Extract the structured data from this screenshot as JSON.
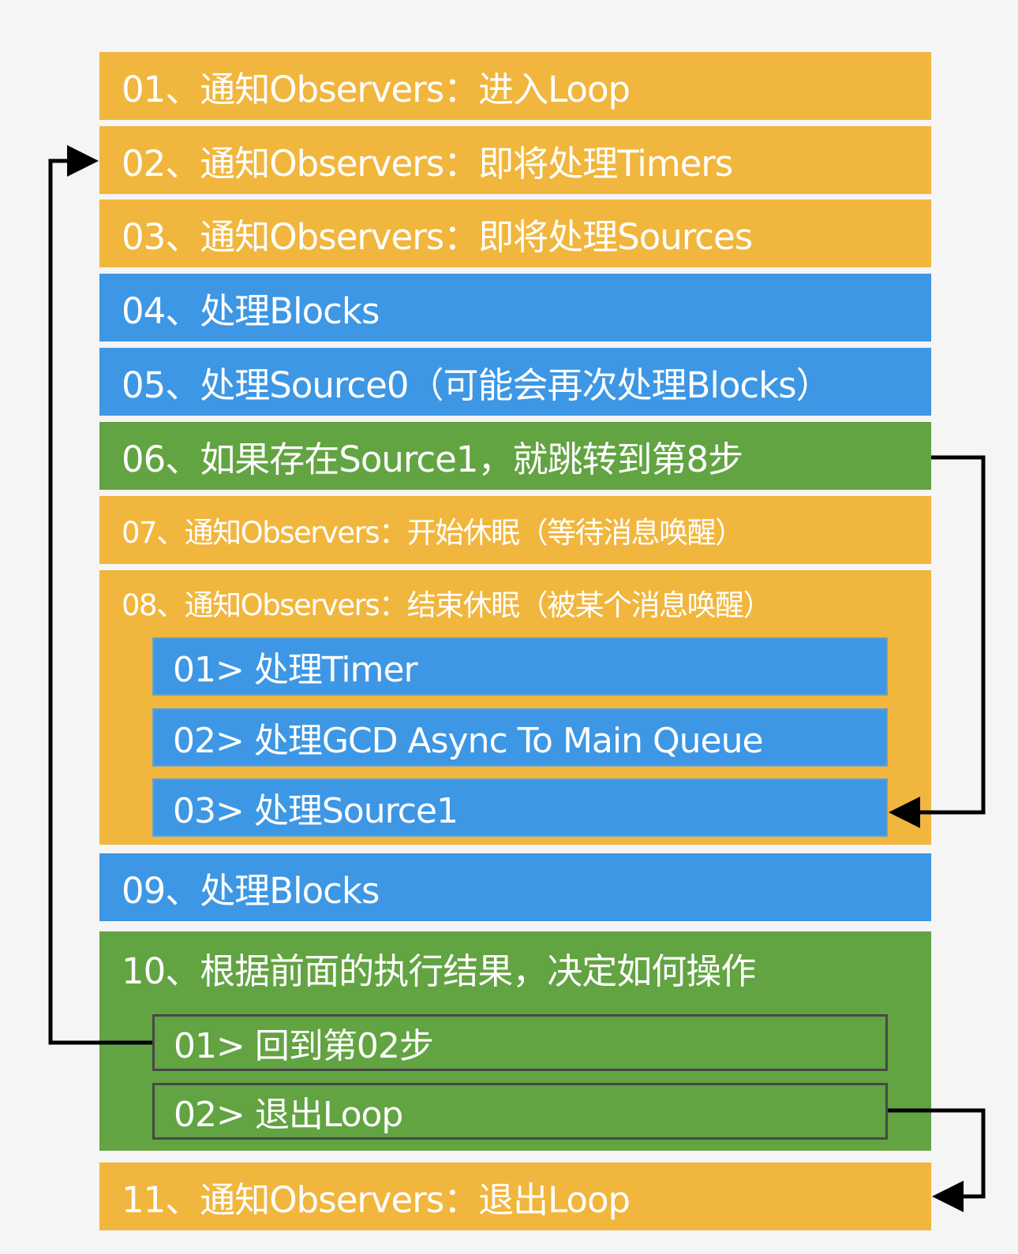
{
  "colors": {
    "notify": "#f1b63d",
    "process": "#3d97e4",
    "decision": "#62a342",
    "arrow": "#000000"
  },
  "steps": [
    {
      "label": "01、通知Observers：进入Loop"
    },
    {
      "label": "02、通知Observers：即将处理Timers"
    },
    {
      "label": "03、通知Observers：即将处理Sources"
    },
    {
      "label": "04、处理Blocks"
    },
    {
      "label": "05、处理Source0（可能会再次处理Blocks）"
    },
    {
      "label": "06、如果存在Source1，就跳转到第8步"
    },
    {
      "label": "07、通知Observers：开始休眠（等待消息唤醒）"
    },
    {
      "label": "08、通知Observers：结束休眠（被某个消息唤醒）",
      "substeps": [
        {
          "label": "01> 处理Timer"
        },
        {
          "label": "02> 处理GCD Async To Main Queue"
        },
        {
          "label": "03> 处理Source1"
        }
      ]
    },
    {
      "label": "09、处理Blocks"
    },
    {
      "label": "10、根据前面的执行结果，决定如何操作",
      "substeps": [
        {
          "label": "01> 回到第02步"
        },
        {
          "label": "02> 退出Loop"
        }
      ]
    },
    {
      "label": "11、通知Observers：退出Loop"
    }
  ]
}
